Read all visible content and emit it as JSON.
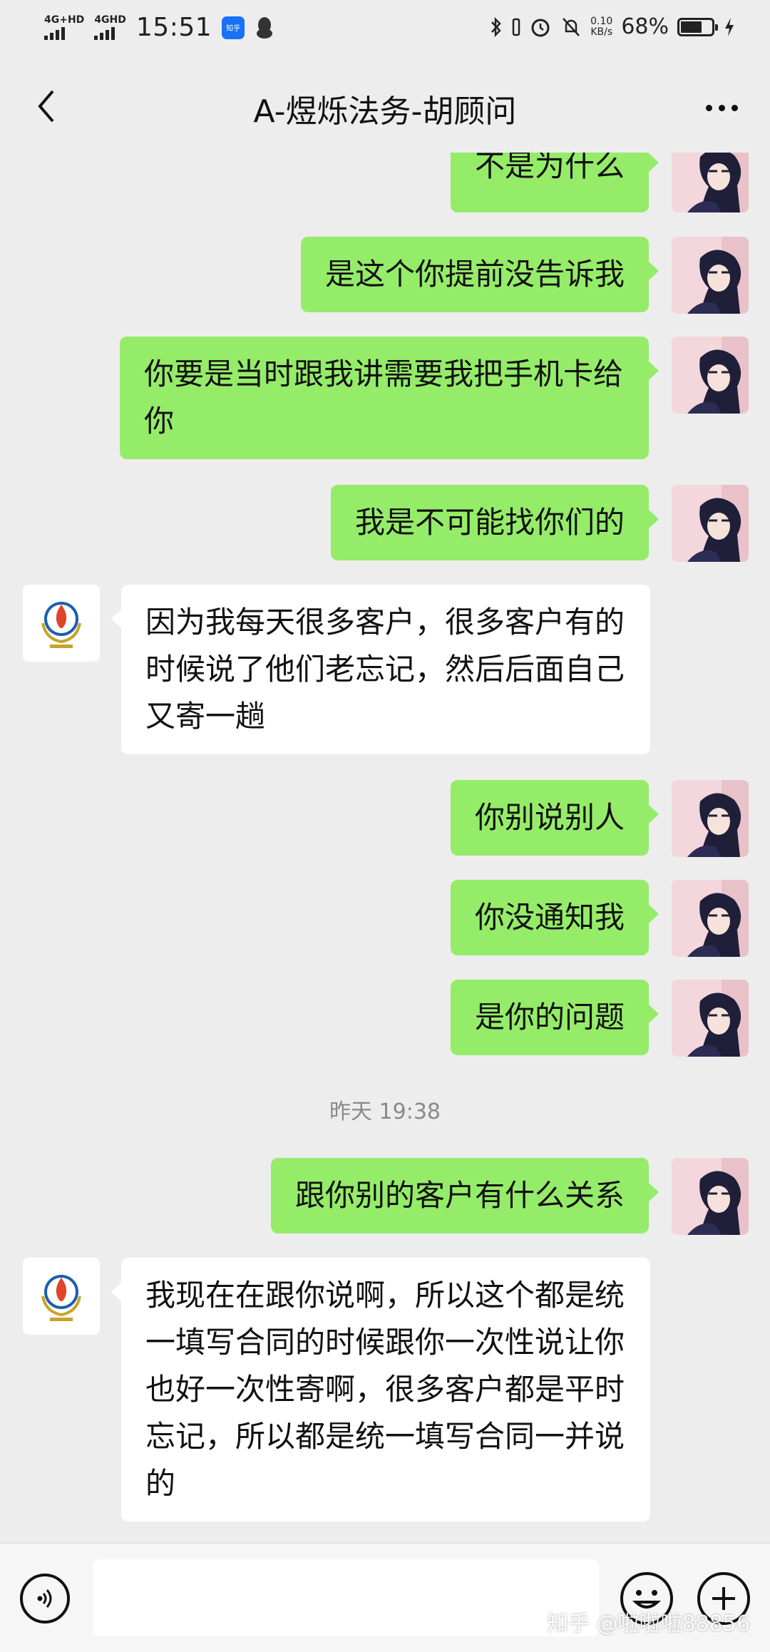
{
  "status_bar": {
    "net1": "4G+HD",
    "net2": "4GHD",
    "time": "15:51",
    "app_badge": "知乎",
    "speed_value": "0.10",
    "speed_unit": "KB/s",
    "battery_percent": "68%",
    "battery_level": 0.68
  },
  "header": {
    "title": "A-煜烁法务-胡顾问"
  },
  "messages": [
    {
      "from": "me",
      "text": "不是为什么"
    },
    {
      "from": "me",
      "text": "是这个你提前没告诉我"
    },
    {
      "from": "me",
      "text": "你要是当时跟我讲需要我把手机卡给你"
    },
    {
      "from": "me",
      "text": "我是不可能找你们的"
    },
    {
      "from": "them",
      "text": "因为我每天很多客户，很多客户有的时候说了他们老忘记，然后后面自己又寄一趟"
    },
    {
      "from": "me",
      "text": "你别说别人"
    },
    {
      "from": "me",
      "text": "你没通知我"
    },
    {
      "from": "me",
      "text": "是你的问题"
    },
    {
      "from": "me",
      "text": "跟你别的客户有什么关系"
    },
    {
      "from": "them",
      "text": "我现在在跟你说啊，所以这个都是统一填写合同的时候跟你一次性说让你也好一次性寄啊，很多客户都是平时忘记，所以都是统一填写合同一并说的"
    }
  ],
  "timestamp": "昨天 19:38",
  "input": {
    "value": "",
    "placeholder": ""
  },
  "watermark": "知乎 @啦啦啦88856",
  "colors": {
    "my_bubble": "#95ec69",
    "their_bubble": "#ffffff",
    "background": "#ededed"
  }
}
